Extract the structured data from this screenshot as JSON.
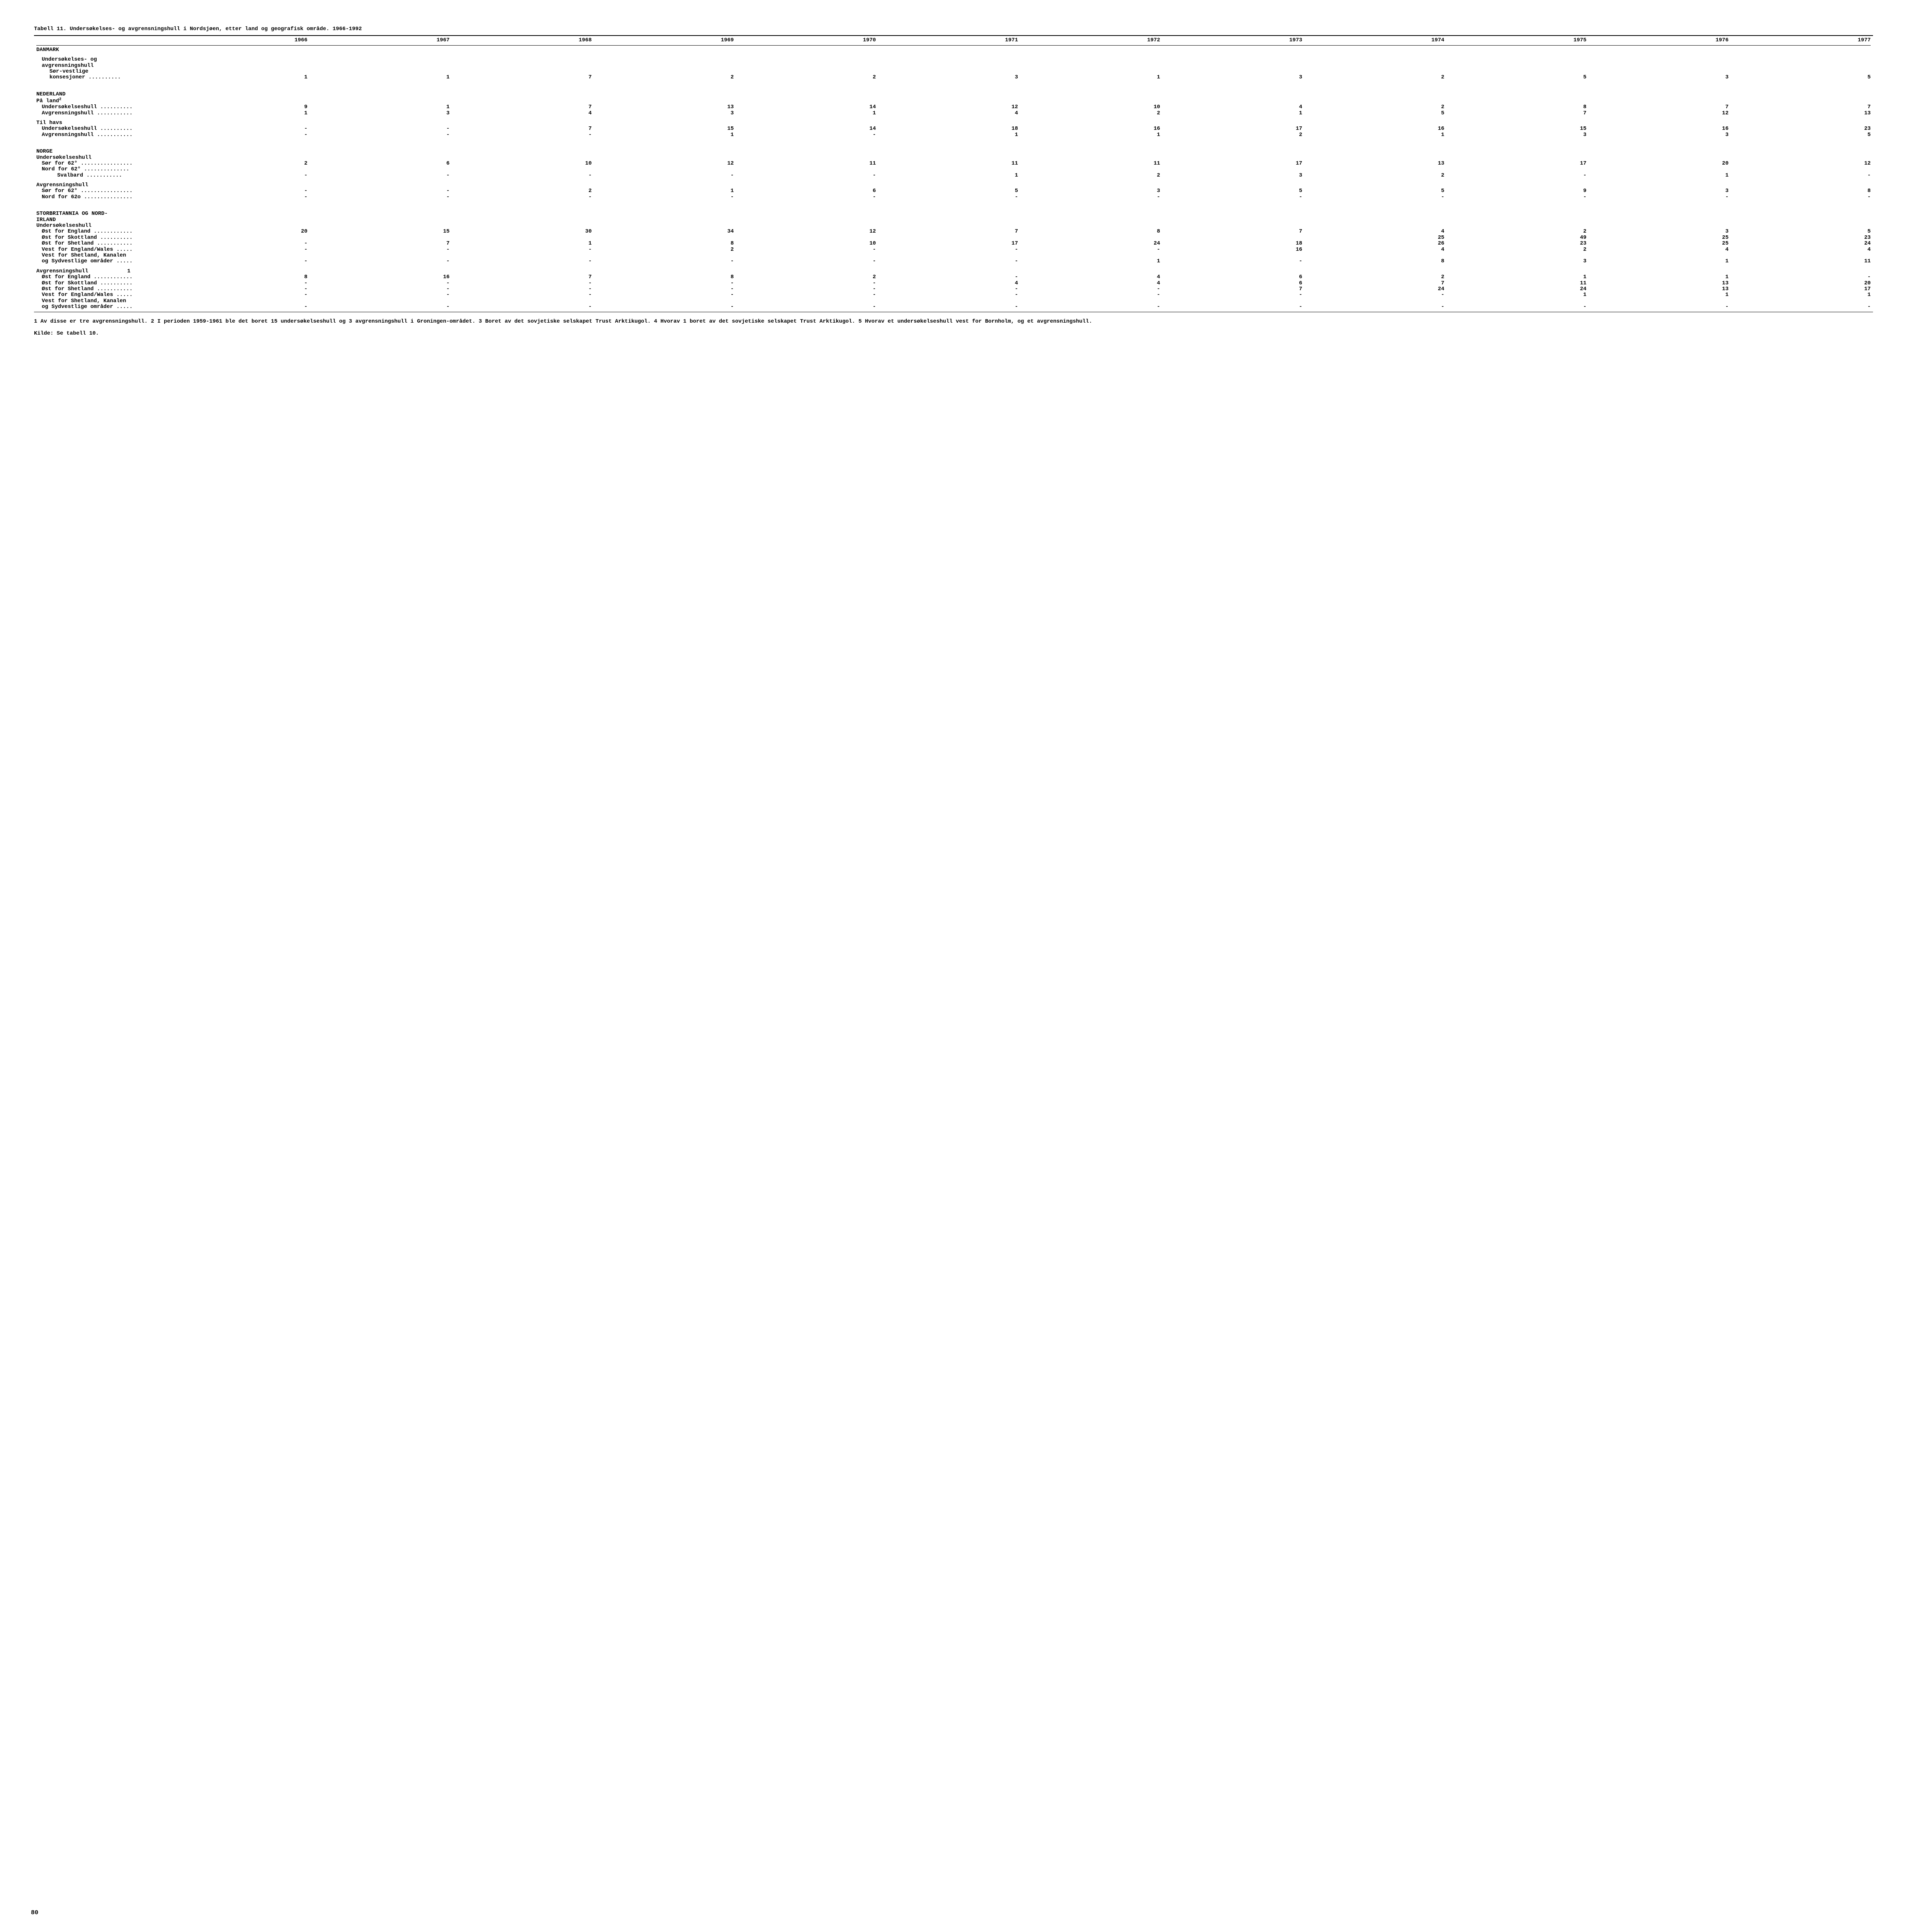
{
  "title": "Tabell 11.  Undersøkelses- og avgrensningshull i Nordsjøen, etter land og geografisk område. 1966-1992",
  "years": [
    "1966",
    "1967",
    "1968",
    "1969",
    "1970",
    "1971",
    "1972",
    "1973",
    "1974",
    "1975",
    "1976",
    "1977"
  ],
  "sections": {
    "danmark": {
      "header": "DANMARK",
      "sub1": "Undersøkelses- og",
      "sub2": "avgrensningshull",
      "sub3": "Sør-vestlige",
      "row": {
        "label": "konsesjoner ..........",
        "vals": [
          "1",
          "1",
          "7",
          "2",
          "2",
          "3",
          "1",
          "3",
          "2",
          "5",
          "3",
          "5"
        ]
      }
    },
    "nederland": {
      "header": "NEDERLAND",
      "land_header": "På land",
      "land_sup": "2",
      "land_u": {
        "label": "Undersøkelseshull ..........",
        "vals": [
          "9",
          "1",
          "7",
          "13",
          "14",
          "12",
          "10",
          "4",
          "2",
          "8",
          "7",
          "7"
        ]
      },
      "land_a": {
        "label": "Avgrensningshull ...........",
        "vals": [
          "1",
          "3",
          "4",
          "3",
          "1",
          "4",
          "2",
          "1",
          "5",
          "7",
          "12",
          "13"
        ]
      },
      "havs_header": "Til havs",
      "havs_u": {
        "label": "Undersøkelseshull ..........",
        "vals": [
          "-",
          "-",
          "7",
          "15",
          "14",
          "18",
          "16",
          "17",
          "16",
          "15",
          "16",
          "23"
        ]
      },
      "havs_a": {
        "label": "Avgrensningshull ...........",
        "vals": [
          "-",
          "-",
          "-",
          "1",
          "-",
          "1",
          "1",
          "2",
          "1",
          "3",
          "3",
          "5"
        ]
      }
    },
    "norge": {
      "header": "NORGE",
      "u_header": "Undersøkelseshull",
      "u_sor": {
        "label": "Sør for 62° ................",
        "vals": [
          "2",
          "6",
          "10",
          "12",
          "11",
          "11",
          "11",
          "17",
          "13",
          "17",
          "20",
          "12"
        ]
      },
      "u_nord": {
        "label": "Nord for 62° ..............",
        "vals": [
          "",
          "",
          "",
          "",
          "",
          "",
          "",
          "",
          "",
          "",
          "",
          ""
        ]
      },
      "u_svalbard": {
        "label": "Svalbard ...........",
        "vals": [
          "-",
          "-",
          "-",
          "-",
          "-",
          "1",
          "2",
          "3",
          "2",
          "-",
          "1",
          "-"
        ]
      },
      "a_header": "Avgrensningshull",
      "a_sor": {
        "label": "Sør for 62° ................",
        "vals": [
          "-",
          "-",
          "2",
          "1",
          "6",
          "5",
          "3",
          "5",
          "5",
          "9",
          "3",
          "8"
        ]
      },
      "a_nord": {
        "label": "Nord for 62o ...............",
        "vals": [
          "-",
          "-",
          "-",
          "-",
          "-",
          "-",
          "-",
          "-",
          "-",
          "-",
          "-",
          "-"
        ]
      }
    },
    "uk": {
      "header1": "STORBRITANNIA OG NORD-",
      "header2": "IRLAND",
      "u_header": "Undersøkelseshull",
      "u_rows": [
        {
          "label": "Øst for England ............",
          "vals": [
            "20",
            "15",
            "30",
            "34",
            "12",
            "7",
            "8",
            "7",
            "4",
            "2",
            "3",
            "5"
          ]
        },
        {
          "label": "Øst for Skottland ..........",
          "vals": [
            "",
            "",
            "",
            "",
            "",
            "",
            "",
            "",
            "25",
            "49",
            "25",
            "23"
          ]
        },
        {
          "label": "Øst for Shetland ...........",
          "vals": [
            "-",
            "7",
            "1",
            "8",
            "10",
            "17",
            "24",
            "18",
            "26",
            "23",
            "25",
            "24"
          ]
        },
        {
          "label": "Vest for England/Wales .....",
          "vals": [
            "-",
            "-",
            "-",
            "2",
            "-",
            "-",
            "-",
            "16",
            "4",
            "2",
            "4",
            "4"
          ]
        },
        {
          "label": "Vest for Shetland, Kanalen",
          "vals": [
            "",
            "",
            "",
            "",
            "",
            "",
            "",
            "",
            "",
            "",
            "",
            ""
          ]
        },
        {
          "label": "og Sydvestlige områder .....",
          "vals": [
            "-",
            "-",
            "-",
            "-",
            "-",
            "-",
            "1",
            "-",
            "8",
            "3",
            "1",
            "11"
          ]
        }
      ],
      "a_header": "Avgrensningshull",
      "a_extra": "1",
      "a_rows": [
        {
          "label": "Øst for England ............",
          "vals": [
            "8",
            "16",
            "7",
            "8",
            "2",
            "-",
            "4",
            "6",
            "2",
            "1",
            "1",
            "-"
          ]
        },
        {
          "label": "Øst for Skottland ..........",
          "vals": [
            "-",
            "-",
            "-",
            "-",
            "-",
            "4",
            "4",
            "6",
            "7",
            "11",
            "13",
            "20"
          ]
        },
        {
          "label": "Øst for Shetland ...........",
          "vals": [
            "-",
            "-",
            "-",
            "-",
            "-",
            "-",
            "-",
            "7",
            "24",
            "24",
            "13",
            "17"
          ]
        },
        {
          "label": "Vest for England/Wales .....",
          "vals": [
            "-",
            "-",
            "-",
            "-",
            "-",
            "-",
            "-",
            "-",
            "-",
            "1",
            "1",
            "1"
          ]
        },
        {
          "label": "Vest for Shetland, Kanalen",
          "vals": [
            "",
            "",
            "",
            "",
            "",
            "",
            "",
            "",
            "",
            "",
            "",
            ""
          ]
        },
        {
          "label": "og Sydvestlige områder .....",
          "vals": [
            "-",
            "-",
            "-",
            "-",
            "-",
            "-",
            "-",
            "-",
            "-",
            "-",
            "-",
            "-"
          ]
        }
      ]
    }
  },
  "footnotes": "1  Av disse er tre avgrensningshull. 2 I perioden 1959-1961 ble det boret 15 undersøkelseshull og 3 avgrensningshull i Groningen-området.  3 Boret av det sovjetiske selskapet Trust Arktikugol. 4 Hvorav 1 boret av det sovjetiske selskapet Trust Arktikugol. 5 Hvorav et undersøkelseshull vest for Bornholm, og et avgrensningshull.",
  "source": "Kilde:  Se tabell 10.",
  "page_number": "80"
}
